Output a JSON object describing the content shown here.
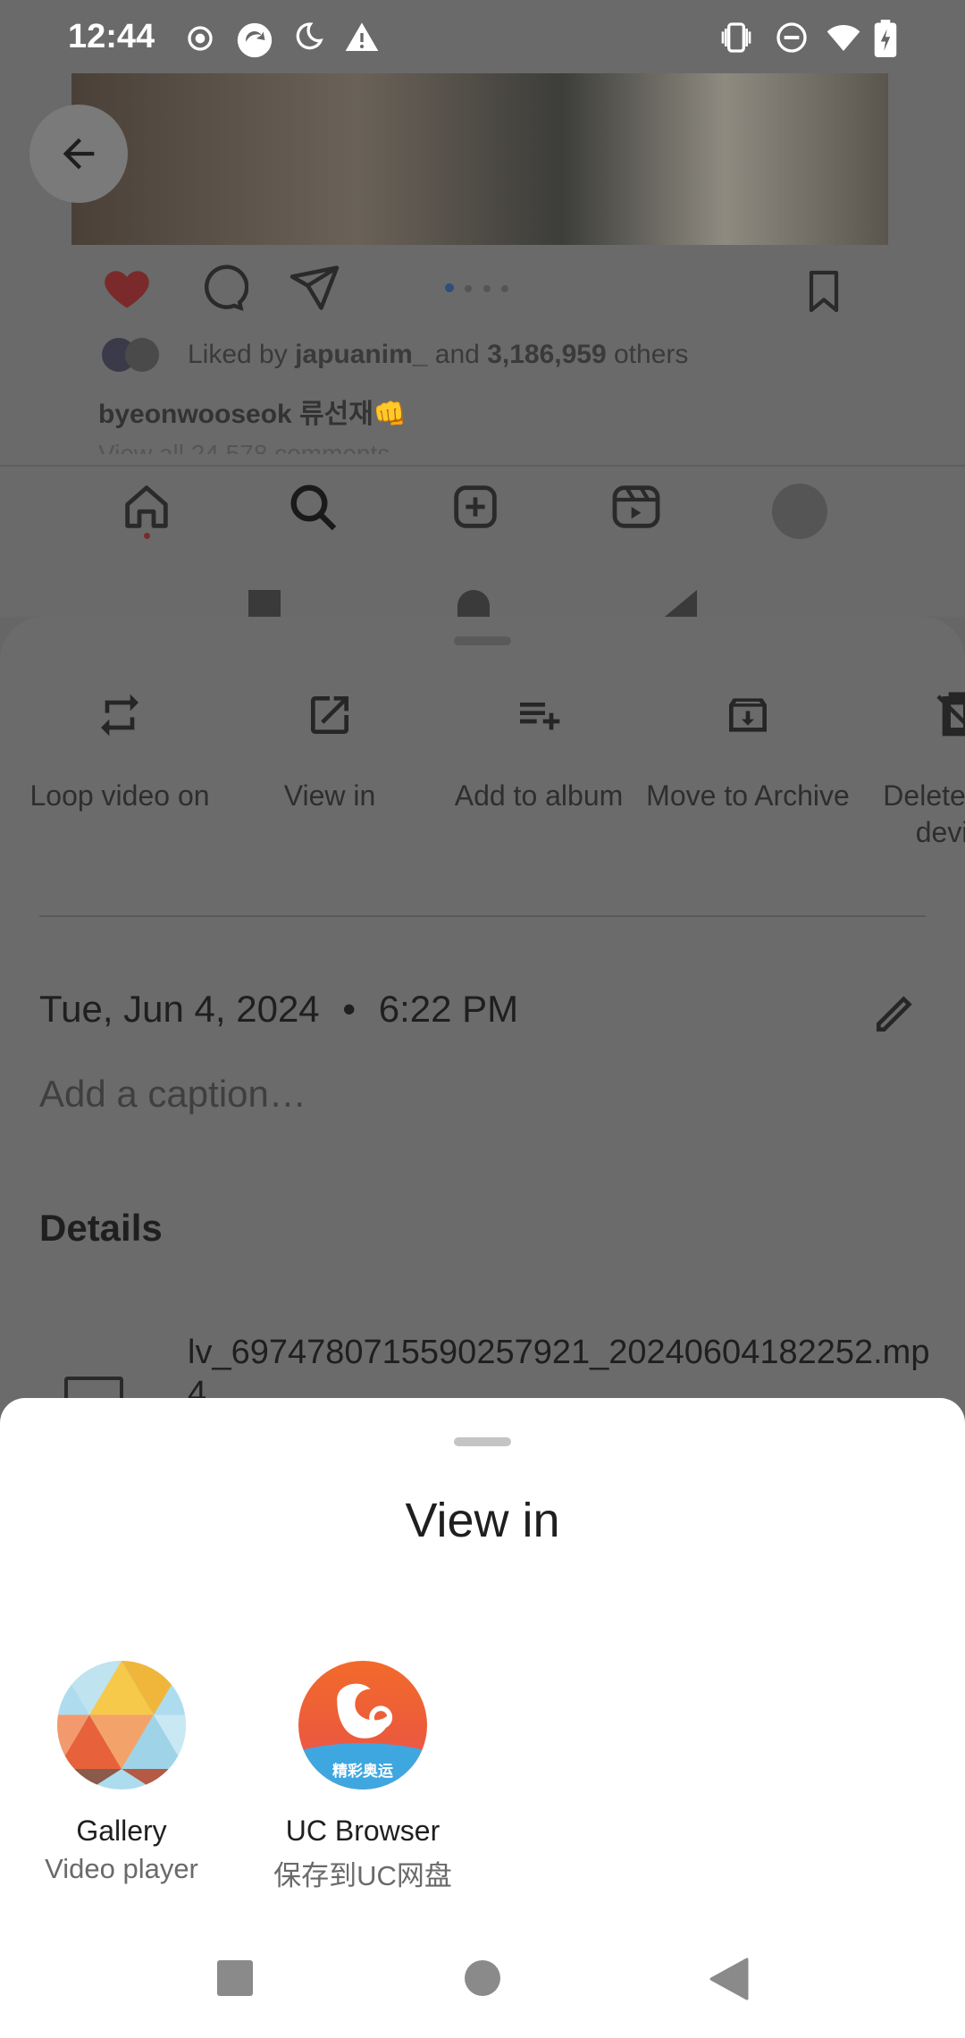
{
  "status_bar": {
    "time": "12:44",
    "left_icons": [
      "record-icon",
      "app-icon",
      "night-mode-icon",
      "warning-icon"
    ],
    "right_icons": [
      "vibrate-icon",
      "dnd-icon",
      "wifi-icon",
      "battery-icon"
    ]
  },
  "background_post": {
    "liked_prefix": "Liked by ",
    "liked_user": "japuanim_",
    "liked_mid": " and ",
    "liked_count": "3,186,959",
    "liked_suffix": " others",
    "username": "byeonwooseok 류선재👊",
    "comments": "View all 24,578 comments"
  },
  "actions": [
    {
      "label": "Loop video on",
      "icon": "loop-icon"
    },
    {
      "label": "View in",
      "icon": "open-external-icon"
    },
    {
      "label": "Add to album",
      "icon": "playlist-add-icon"
    },
    {
      "label": "Move to Archive",
      "icon": "archive-icon"
    },
    {
      "label": "Delete from device",
      "icon": "delete-device-icon"
    }
  ],
  "info": {
    "date": "Tue, Jun 4, 2024",
    "separator": "•",
    "time": "6:22 PM",
    "caption_placeholder": "Add a caption…",
    "details_heading": "Details",
    "file_name": "lv_6974780715590257921_20240604182252.mp4"
  },
  "sheet": {
    "title": "View in",
    "apps": [
      {
        "name": "Gallery",
        "subtitle": "Video player",
        "icon": "gallery-app-icon"
      },
      {
        "name": "UC Browser",
        "subtitle": "保存到UC网盘",
        "icon": "uc-browser-app-icon",
        "badge_text": "精彩奥运"
      }
    ]
  },
  "colors": {
    "scrim": "#666666",
    "sheet_bg": "#ffffff",
    "text_primary": "#1f1f1f",
    "text_secondary": "#6a6a6a"
  }
}
